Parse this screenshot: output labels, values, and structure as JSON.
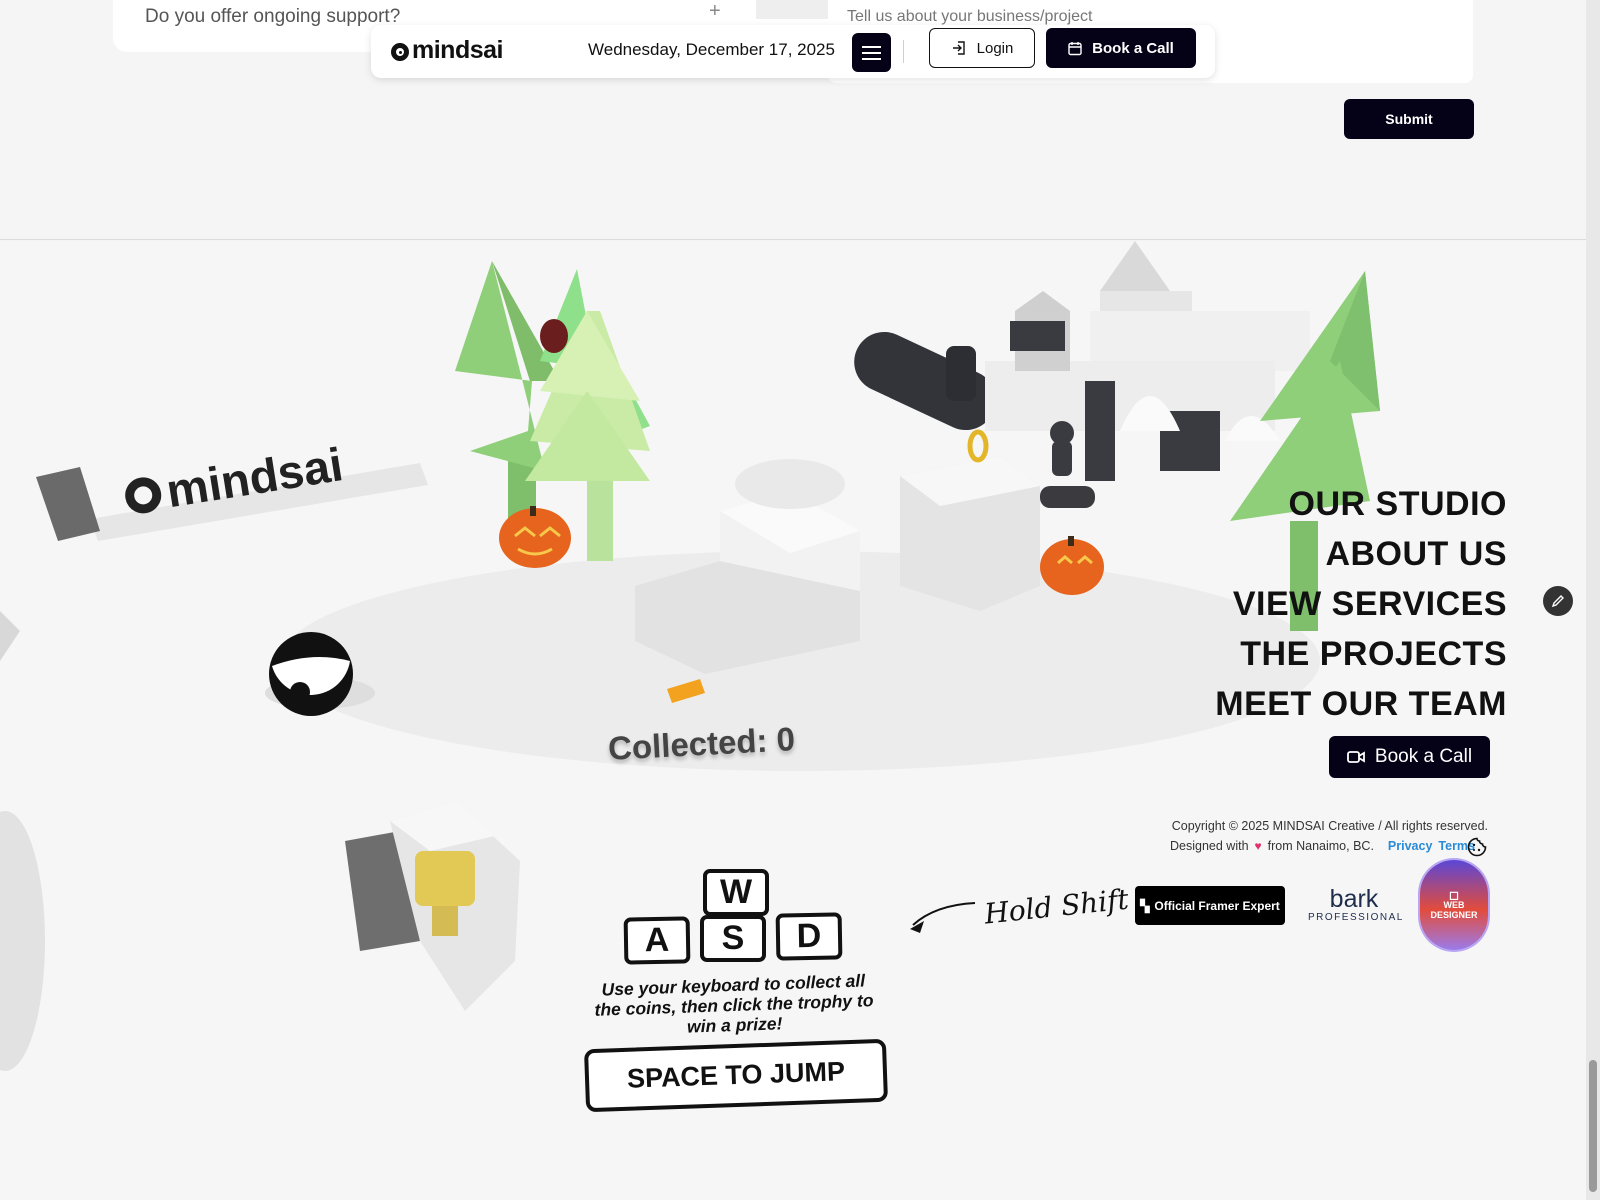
{
  "faq": {
    "question": "Do you offer ongoing support?",
    "toggle_icon": "plus-icon"
  },
  "contact_form": {
    "message_placeholder": "Tell us about your business/project",
    "submit_label": "Submit"
  },
  "navbar": {
    "brand": "mindsai",
    "date": "Wednesday, December 17, 2025",
    "menu_icon": "hamburger-icon",
    "login_label": "Login",
    "book_label": "Book a Call"
  },
  "game": {
    "collected_label": "Collected: 0",
    "scene_brand": "mindsai",
    "keys": [
      "W",
      "A",
      "S",
      "D"
    ],
    "instructions": "Use your keyboard to collect all the coins, then click the trophy to win a prize!",
    "jump_label": "SPACE TO JUMP",
    "shift_hint": "Hold Shift t"
  },
  "footer": {
    "menu": [
      "OUR STUDIO",
      "ABOUT US",
      "VIEW SERVICES",
      "THE PROJECTS",
      "MEET OUR TEAM"
    ],
    "book_label": "Book a Call",
    "copyright": "Copyright © 2025 MINDSAI Creative / All rights reserved.",
    "designed_prefix": "Designed with",
    "designed_suffix": "from Nanaimo, BC.",
    "privacy_label": "Privacy",
    "terms_label": "Terms",
    "framer_badge": "Official Framer Expert",
    "bark_name": "bark",
    "bark_sub": "PROFESSIONAL",
    "seal_text": "WEB DESIGNER"
  },
  "colors": {
    "primary_dark": "#050217",
    "link_blue": "#2a8bd6",
    "accent_red": "#e8433a",
    "tree_green": "#8fcf7a",
    "pumpkin_orange": "#e6641e"
  }
}
